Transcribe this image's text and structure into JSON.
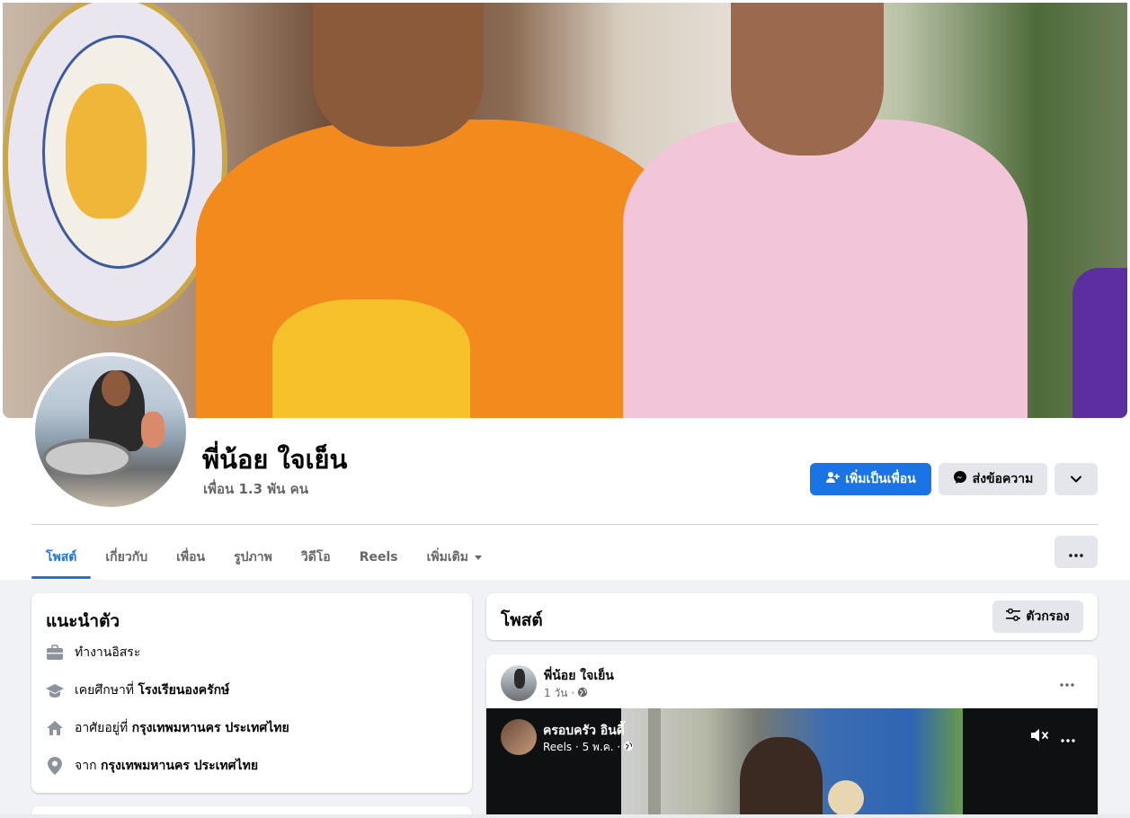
{
  "profile": {
    "name": "พี่น้อย ใจเย็น",
    "friends": "เพื่อน 1.3 พัน คน"
  },
  "actions": {
    "add_friend": "เพิ่มเป็นเพื่อน",
    "message": "ส่งข้อความ",
    "more_icon": "chevron-down-icon"
  },
  "tabs": [
    {
      "label": "โพสต์",
      "active": true
    },
    {
      "label": "เกี่ยวกับ"
    },
    {
      "label": "เพื่อน"
    },
    {
      "label": "รูปภาพ"
    },
    {
      "label": "วิดีโอ"
    },
    {
      "label": "Reels"
    },
    {
      "label": "เพิ่มเติม"
    }
  ],
  "intro": {
    "title": "แนะนำตัว",
    "work": "ทำงานอิสระ",
    "education_prefix": "เคยศึกษาที่",
    "education_place": "โรงเรียนองครักษ์",
    "lives_prefix": "อาศัยอยู่ที่",
    "lives_place": "กรุงเทพมหานคร ประเทศไทย",
    "from_prefix": "จาก",
    "from_place": "กรุงเทพมหานคร ประเทศไทย"
  },
  "posts_header": {
    "title": "โพสต์",
    "filter_label": "ตัวกรอง"
  },
  "post": {
    "author": "พี่น้อย ใจเย็น",
    "time": "1 วัน ·",
    "video": {
      "author": "ครอบครัว อินดี้",
      "meta": "Reels · 5 พ.ค. ·"
    }
  },
  "colors": {
    "accent": "#1b74e4",
    "page_bg": "#f0f2f5",
    "secondary_button": "#e4e6eb",
    "muted_text": "#65676b"
  }
}
